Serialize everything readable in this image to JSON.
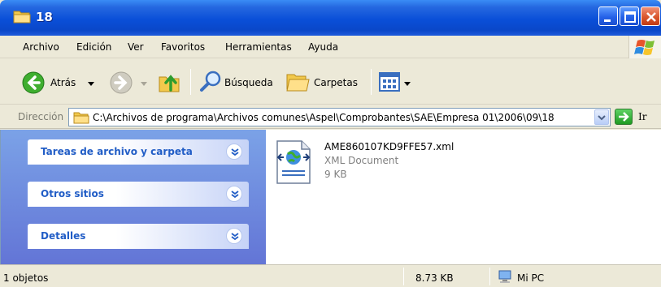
{
  "window": {
    "title": "18"
  },
  "menu": [
    "Archivo",
    "Edición",
    "Ver",
    "Favoritos",
    "Herramientas",
    "Ayuda"
  ],
  "toolbar": {
    "back_label": "Atrás",
    "search_label": "Búsqueda",
    "folders_label": "Carpetas"
  },
  "address": {
    "label": "Dirección",
    "path": "C:\\Archivos de programa\\Archivos comunes\\Aspel\\Comprobantes\\SAE\\Empresa 01\\2006\\09\\18",
    "go_label": "Ir"
  },
  "taskpane": {
    "groups": [
      {
        "label": "Tareas de archivo y carpeta"
      },
      {
        "label": "Otros sitios"
      },
      {
        "label": "Detalles"
      }
    ]
  },
  "files": [
    {
      "name": "AME860107KD9FFE57.xml",
      "type": "XML Document",
      "size": "9 KB"
    }
  ],
  "status": {
    "count": "1 objetos",
    "size": "8.73 KB",
    "location": "Mi PC"
  },
  "colors": {
    "titlebar": "#0A4FD8",
    "taskpane": "#6F8EE0",
    "group_label": "#215DC6",
    "chrome": "#ECE9D8"
  }
}
